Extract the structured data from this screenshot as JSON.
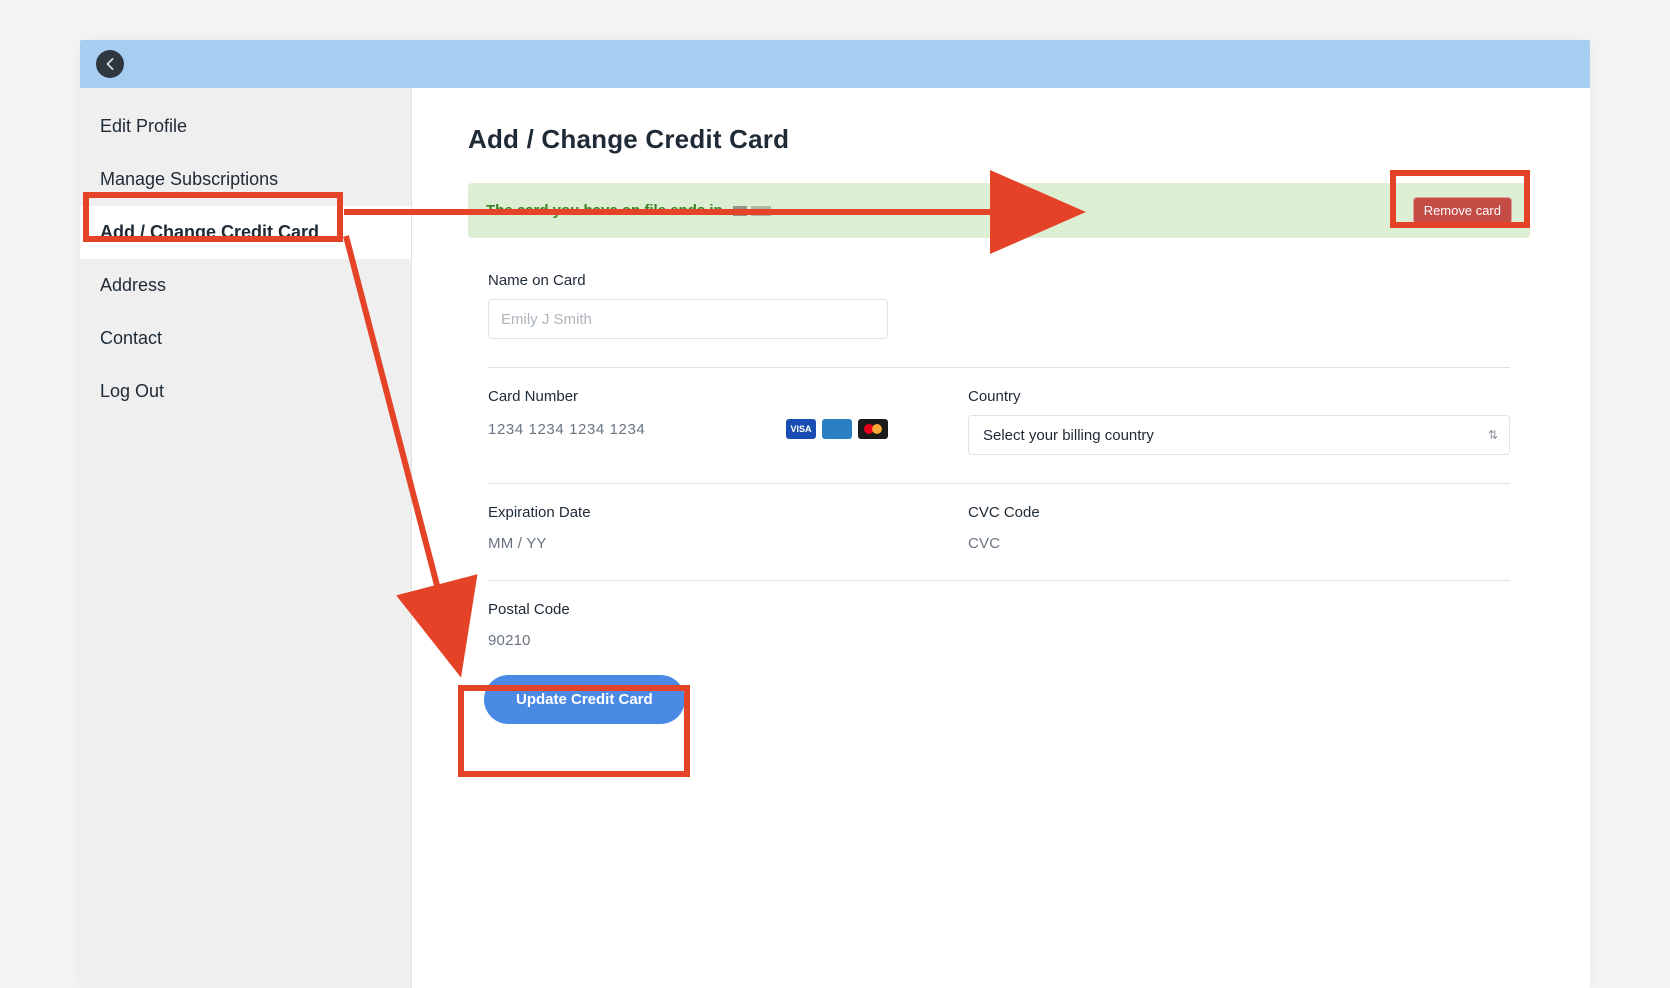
{
  "sidebar": {
    "items": [
      {
        "label": "Edit Profile"
      },
      {
        "label": "Manage Subscriptions"
      },
      {
        "label": "Add / Change Credit Card"
      },
      {
        "label": "Address"
      },
      {
        "label": "Contact"
      },
      {
        "label": "Log Out"
      }
    ],
    "active_index": 2
  },
  "main": {
    "title": "Add / Change Credit Card",
    "alert_text": "The card you have on file ends in",
    "remove_card_label": "Remove card",
    "name_label": "Name on Card",
    "name_placeholder": "Emily J Smith",
    "card_number_label": "Card Number",
    "card_number_placeholder": "1234 1234 1234 1234",
    "country_label": "Country",
    "country_placeholder": "Select your billing country",
    "expiration_label": "Expiration Date",
    "expiration_placeholder": "MM / YY",
    "cvc_label": "CVC Code",
    "cvc_placeholder": "CVC",
    "postal_label": "Postal Code",
    "postal_placeholder": "90210",
    "submit_label": "Update Credit Card",
    "card_brands": [
      "VISA",
      "AMEX",
      "MC"
    ]
  },
  "colors": {
    "highlight": "#e54327",
    "primary": "#4a8ae4",
    "danger": "#c54b45"
  }
}
